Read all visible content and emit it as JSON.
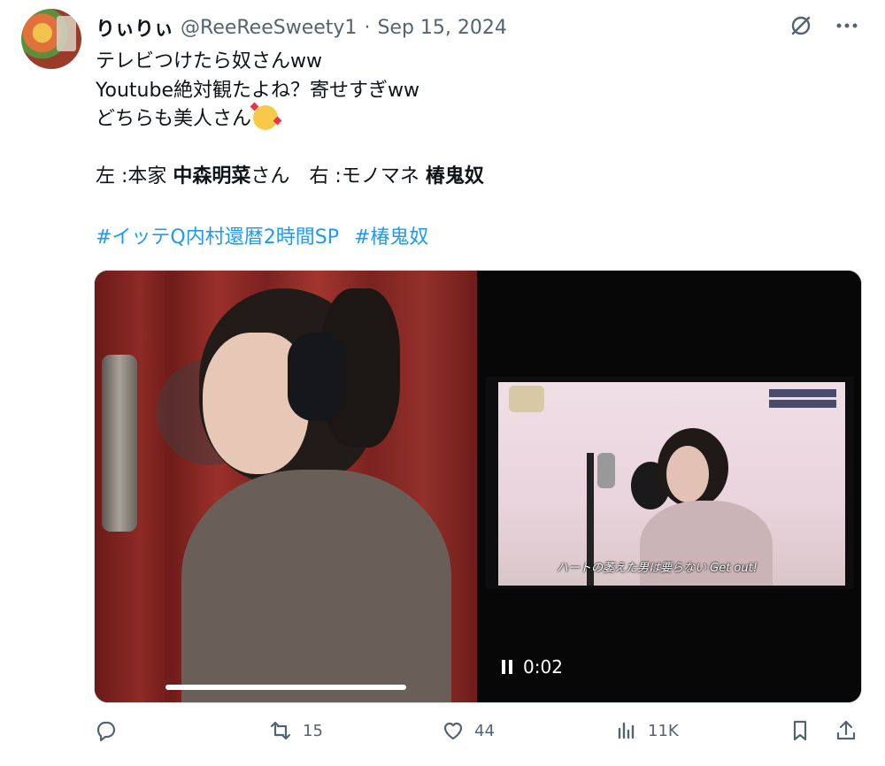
{
  "tweet": {
    "display_name": "りぃりぃ",
    "handle": "@ReeReeSweety1",
    "separator": "·",
    "date": "Sep 15, 2024",
    "lines": [
      "テレビつけたら奴さんww",
      "Youtube絶対観たよね？寄せすぎww",
      "どちらも美人さん"
    ],
    "caption": {
      "left_prefix": "左 :本家 ",
      "left_name": "中森明菜",
      "left_suffix": "さん",
      "right_prefix": "右 :モノマネ ",
      "right_name": "椿鬼奴"
    },
    "hashtags": [
      "#イッテQ内村還暦2時間SP",
      "#椿鬼奴"
    ]
  },
  "media": {
    "tv_subtitle": "ハートの萎えた男は要らない Get out!",
    "video_time": "0:02"
  },
  "actions": {
    "reply_count": "",
    "retweet_count": "15",
    "like_count": "44",
    "views_count": "11K"
  },
  "icons": {
    "header": [
      "grok-icon",
      "more-icon"
    ],
    "actions": [
      "reply-icon",
      "retweet-icon",
      "like-icon",
      "views-icon",
      "bookmark-icon",
      "share-icon"
    ]
  },
  "colors": {
    "link": "#1d9bf0",
    "secondary_text": "#536471",
    "primary_text": "#0f1419"
  }
}
